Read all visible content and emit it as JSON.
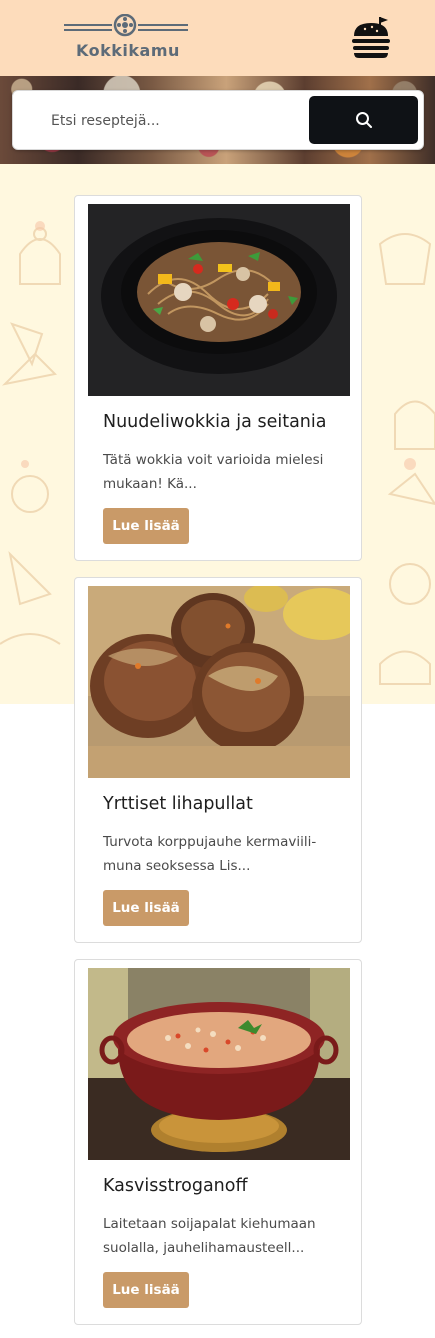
{
  "header": {
    "brand": "Kokkikamu",
    "menu_icon": "hamburger-icon"
  },
  "search": {
    "placeholder": "Etsi reseptejä...",
    "button_icon": "search-icon"
  },
  "recipes": [
    {
      "title": "Nuudeliwokkia ja seitania",
      "desc_line1": "Tätä wokkia voit varioida mielesi",
      "desc_line2": "mukaan! Kä...",
      "button": "Lue lisää",
      "image_icon": "noodle-wok-image"
    },
    {
      "title": "Yrttiset lihapullat",
      "desc_line1": "Turvota korppujauhe kermaviili-",
      "desc_line2": "muna seoksessa Lis...",
      "button": "Lue lisää",
      "image_icon": "meatballs-image"
    },
    {
      "title": "Kasvisstroganoff",
      "desc_line1": "Laitetaan soijapalat kiehumaan",
      "desc_line2": "suolalla, jauhelihamausteell...",
      "button": "Lue lisää",
      "image_icon": "stew-pot-image"
    }
  ],
  "colors": {
    "header_bg": "#fddcbb",
    "search_button": "#0f1216",
    "card_button": "#c99a68",
    "pattern_bg": "#fff8df"
  }
}
